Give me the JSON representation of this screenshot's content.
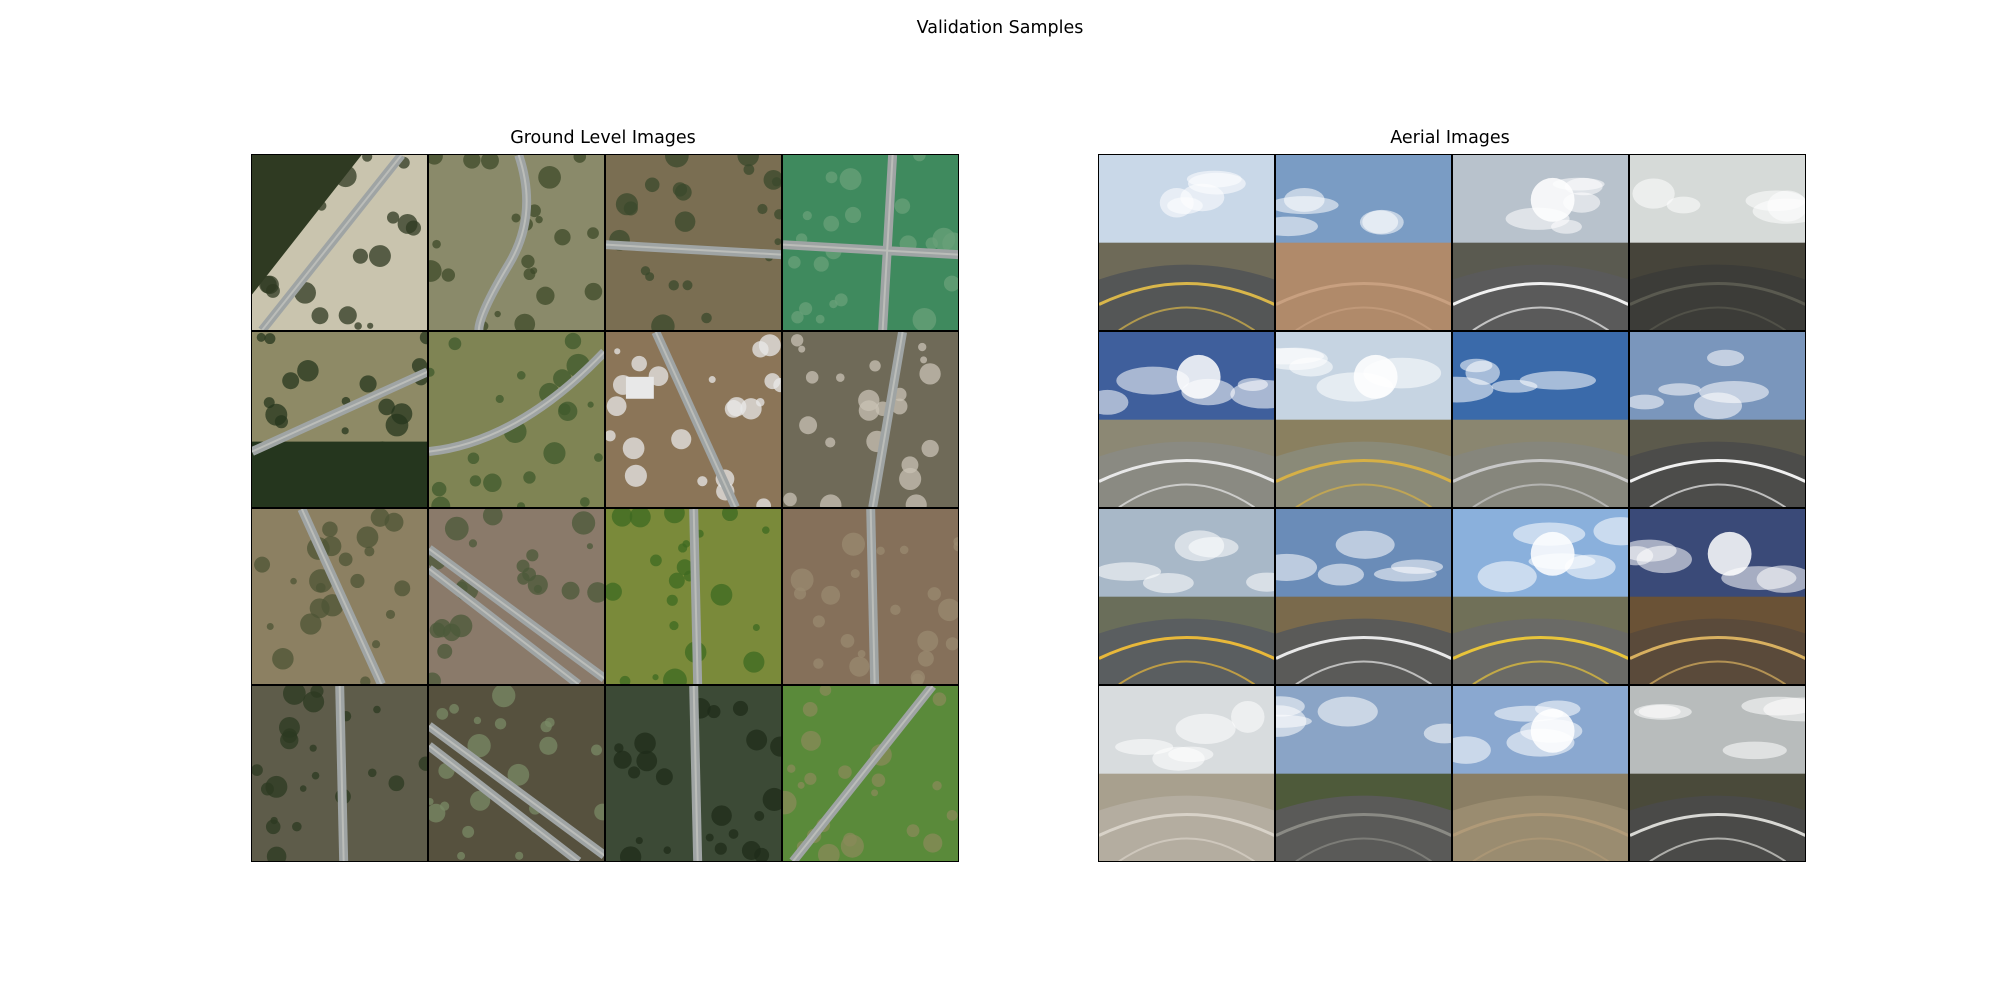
{
  "figure": {
    "suptitle": "Validation Samples"
  },
  "panels": {
    "left": {
      "title": "Ground Level Images",
      "tiles": [
        {
          "kind": "aerial",
          "ground": "#c9c4ae",
          "accent": "#2f3a22",
          "road": "diagonal-ne",
          "feature": "forest-left"
        },
        {
          "kind": "aerial",
          "ground": "#8a8a6a",
          "accent": "#3d4a2a",
          "road": "dirt-curve",
          "feature": "shrubs"
        },
        {
          "kind": "aerial",
          "ground": "#7a6e52",
          "accent": "#3b4a2c",
          "road": "horizontal",
          "feature": "buildings"
        },
        {
          "kind": "aerial",
          "ground": "#3f8a5e",
          "accent": "#6aa07a",
          "road": "cross",
          "feature": "green"
        },
        {
          "kind": "aerial",
          "ground": "#8e8a66",
          "accent": "#25361e",
          "road": "diagonal-se",
          "feature": "trees-bottom"
        },
        {
          "kind": "aerial",
          "ground": "#7f8454",
          "accent": "#3f5a2c",
          "road": "curve-up",
          "feature": "tree-line"
        },
        {
          "kind": "aerial",
          "ground": "#8b7558",
          "accent": "#e8e8e8",
          "road": "diagonal-nw",
          "feature": "building"
        },
        {
          "kind": "aerial",
          "ground": "#6f6a58",
          "accent": "#c8c2b4",
          "road": "vertical-right",
          "feature": "rocky"
        },
        {
          "kind": "aerial",
          "ground": "#8c8062",
          "accent": "#4d5436",
          "road": "diagonal-nw",
          "feature": "fields"
        },
        {
          "kind": "aerial",
          "ground": "#8a7a6a",
          "accent": "#4b5a3a",
          "road": "highway-diag",
          "feature": "shrubs"
        },
        {
          "kind": "aerial",
          "ground": "#7a8a3a",
          "accent": "#3d6a22",
          "road": "vertical-center",
          "feature": "fields"
        },
        {
          "kind": "aerial",
          "ground": "#85705a",
          "accent": "#9a8a70",
          "road": "vertical-center",
          "feature": "rows"
        },
        {
          "kind": "aerial",
          "ground": "#5e5c4a",
          "accent": "#2c3a22",
          "road": "vertical-center",
          "feature": "trees"
        },
        {
          "kind": "aerial",
          "ground": "#56513e",
          "accent": "#7a8a66",
          "road": "highway-diag",
          "feature": "fields"
        },
        {
          "kind": "aerial",
          "ground": "#3c4a36",
          "accent": "#1f2c1a",
          "road": "vertical-center",
          "feature": "orchard"
        },
        {
          "kind": "aerial",
          "ground": "#5a8a3a",
          "accent": "#8a8a5a",
          "road": "diagonal-ne",
          "feature": "grass"
        }
      ]
    },
    "right": {
      "title": "Aerial Images",
      "tiles": [
        {
          "kind": "pano",
          "sky": "#c9d8e8",
          "ground": "#6e6a58",
          "road": "#545656",
          "line": "#d9b64a",
          "sun": false
        },
        {
          "kind": "pano",
          "sky": "#7a9cc4",
          "ground": "#b08a6a",
          "road": "#b08a6a",
          "line": "#c8a080",
          "sun": false
        },
        {
          "kind": "pano",
          "sky": "#b8c2cc",
          "ground": "#5a5a50",
          "road": "#5a5a5a",
          "line": "#f0f0f0",
          "sun": true
        },
        {
          "kind": "pano",
          "sky": "#d6dad8",
          "ground": "#46443a",
          "road": "#3c3c38",
          "line": "#5a5a50",
          "sun": false
        },
        {
          "kind": "pano",
          "sky": "#3f5f9c",
          "ground": "#8c8874",
          "road": "#8a8a82",
          "line": "#e8e8e8",
          "sun": true
        },
        {
          "kind": "pano",
          "sky": "#c6d4e2",
          "ground": "#8a8060",
          "road": "#8a8a78",
          "line": "#d6b046",
          "sun": true
        },
        {
          "kind": "pano",
          "sky": "#3a6aaa",
          "ground": "#8a8670",
          "road": "#86867c",
          "line": "#c8c8c8",
          "sun": false
        },
        {
          "kind": "pano",
          "sky": "#7a96bc",
          "ground": "#5c5a4c",
          "road": "#4c4c4a",
          "line": "#f0f0f0",
          "sun": false
        },
        {
          "kind": "pano",
          "sky": "#a8b8c8",
          "ground": "#6a6e5a",
          "road": "#5a5e60",
          "line": "#e8b83a",
          "sun": false
        },
        {
          "kind": "pano",
          "sky": "#6a8cb8",
          "ground": "#7a6a4c",
          "road": "#5a5a58",
          "line": "#e8e8e8",
          "sun": false
        },
        {
          "kind": "pano",
          "sky": "#8ab0dc",
          "ground": "#707058",
          "road": "#6a6a66",
          "line": "#e8c43a",
          "sun": true
        },
        {
          "kind": "pano",
          "sky": "#3a4a78",
          "ground": "#6a5236",
          "road": "#5a4a3a",
          "line": "#d8b060",
          "sun": true
        },
        {
          "kind": "pano",
          "sky": "#d8dcde",
          "ground": "#a8a08e",
          "road": "#b4ada0",
          "line": "#d8d2c8",
          "sun": false
        },
        {
          "kind": "pano",
          "sky": "#8aa4c6",
          "ground": "#4e5a3a",
          "road": "#5a5a58",
          "line": "#8a8a84",
          "sun": false
        },
        {
          "kind": "pano",
          "sky": "#8aa8d0",
          "ground": "#8a7e64",
          "road": "#9a8c70",
          "line": "#b09a78",
          "sun": true
        },
        {
          "kind": "pano",
          "sky": "#b8bcbc",
          "ground": "#4a4a3a",
          "road": "#4a4a48",
          "line": "#d8d8d4",
          "sun": false
        }
      ]
    }
  }
}
